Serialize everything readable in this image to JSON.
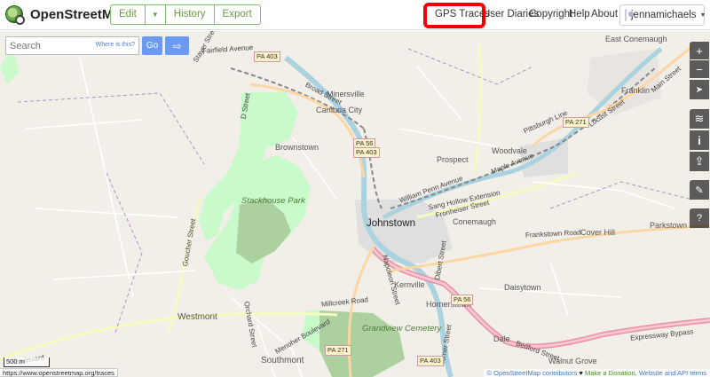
{
  "header": {
    "brand": "OpenStreetMap",
    "edit_label": "Edit",
    "edit_caret": "▼",
    "history_label": "History",
    "export_label": "Export",
    "nav": {
      "gps_traces": "GPS Traces",
      "user_diaries": "User Diaries",
      "copyright": "Copyright",
      "help": "Help",
      "about": "About"
    },
    "username": "jennamichaels"
  },
  "search": {
    "placeholder": "Search",
    "where_is_this": "Where is this?",
    "go_label": "Go"
  },
  "map": {
    "places": {
      "johnstown": "Johnstown",
      "brownstown": "Brownstown",
      "stackhouse_park": "Stackhouse Park",
      "cambria_city": "Cambria City",
      "minersville": "Minersville",
      "prospect": "Prospect",
      "woodvale": "Woodvale",
      "conemaugh": "Conemaugh",
      "daisytown": "Daisytown",
      "westmont": "Westmont",
      "southmont": "Southmont",
      "hornerstown": "Hornerstown",
      "kernville": "Kernville",
      "grandview_cemetery": "Grandview Cemetery",
      "east_conemaugh": "East Conemaugh",
      "franklin": "Franklin",
      "cover_hill": "Cover Hill",
      "parkstown": "Parkstown",
      "dale": "Dale",
      "walnut_grove": "Walnut Grove"
    },
    "roads": {
      "fairfield_avenue": "Fairfield Avenue",
      "broad_street": "Broad Street",
      "frankstown_road": "Frankstown Road",
      "millcreek_road": "Millcreek Road",
      "sang_hollow": "Sang Hollow Extension",
      "william_penn": "William Penn Avenue",
      "main_street": "Main Street",
      "bedford_street": "Bedford Street",
      "goucher_street": "Goucher Street",
      "expressway_bypass": "Expressway Bypass",
      "maple_avenue": "Maple Avenue",
      "fronheiser": "Fronheiser Street",
      "d_street": "D Street",
      "boulevard": "Boulevard",
      "horner_street": "Horner Street",
      "pittsburgh_line": "Pittsburgh Line",
      "locust_street": "Locust Street",
      "menoher": "Menoher Boulevard",
      "dibert": "Dibert Street",
      "orchard": "Orchard Street",
      "stayer": "Stayer Street",
      "napoleon": "Napoleon Street"
    },
    "shields": {
      "pa403_top": "PA 403",
      "pa56": "PA 56",
      "pa403_mid": "PA 403",
      "pa271_right": "PA 271",
      "pa56_south": "PA 56",
      "pa271_south": "PA 271",
      "pa403_south": "PA 403"
    },
    "scale": "500 m",
    "status_url": "https://www.openstreetmap.org/traces",
    "attribution": {
      "copy": "© OpenStreetMap contributors",
      "heart": " ♥ ",
      "donate": "Make a Donation",
      "dot": ". ",
      "terms": "Website and API terms"
    }
  },
  "controls": {
    "zoom_in": "+",
    "zoom_out": "−",
    "locate": "➤",
    "layers": "≋",
    "info": "i",
    "share": "⇪",
    "note": "✎",
    "query": "?"
  },
  "colors": {
    "accent": "#7ebc6f",
    "highlight": "#e00000",
    "map_bg": "#f2efe9",
    "park": "#c8facc",
    "river": "#aad3df",
    "motorway": "#e892a2",
    "primary": "#fcd6a4"
  }
}
